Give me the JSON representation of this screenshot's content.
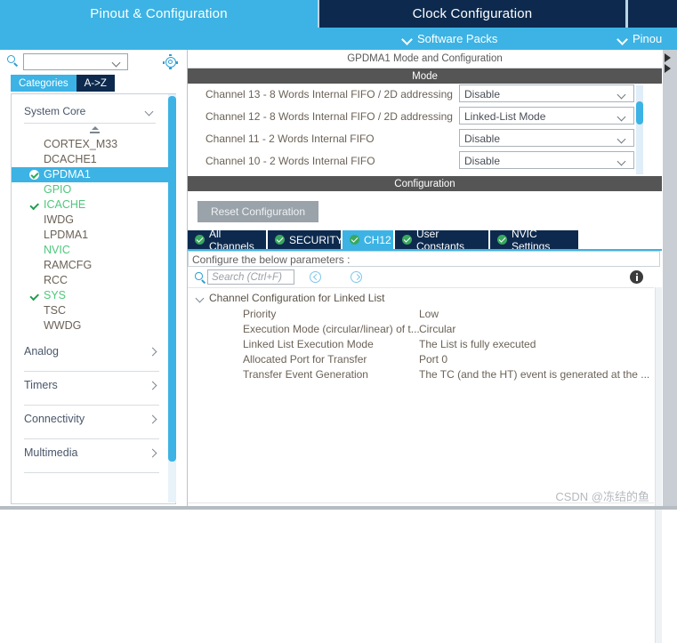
{
  "tabs": {
    "pinout_configuration": "Pinout & Configuration",
    "clock_configuration": "Clock Configuration",
    "right_stub": ""
  },
  "subbar": {
    "software_packs": "Software Packs",
    "pinout": "Pinou"
  },
  "sidebar": {
    "search_value": "",
    "search_placeholder": "",
    "pill_categories": "Categories",
    "pill_az": "A->Z",
    "group_header": "System Core",
    "peripherals": [
      {
        "label": "CORTEX_M33",
        "state": "none"
      },
      {
        "label": "DCACHE1",
        "state": "none"
      },
      {
        "label": "GPDMA1",
        "state": "selected"
      },
      {
        "label": "GPIO",
        "state": "configured"
      },
      {
        "label": "ICACHE",
        "state": "checked"
      },
      {
        "label": "IWDG",
        "state": "none"
      },
      {
        "label": "LPDMA1",
        "state": "none"
      },
      {
        "label": "NVIC",
        "state": "configured"
      },
      {
        "label": "RAMCFG",
        "state": "none"
      },
      {
        "label": "RCC",
        "state": "none"
      },
      {
        "label": "SYS",
        "state": "checked"
      },
      {
        "label": "TSC",
        "state": "none"
      },
      {
        "label": "WWDG",
        "state": "none"
      }
    ],
    "categories": [
      {
        "label": "Analog"
      },
      {
        "label": "Timers"
      },
      {
        "label": "Connectivity"
      },
      {
        "label": "Multimedia"
      }
    ]
  },
  "main": {
    "title": "GPDMA1 Mode and Configuration",
    "mode_header": "Mode",
    "mode_rows": [
      {
        "label": "Channel 13 - 8 Words Internal FIFO / 2D addressing",
        "value": "Disable"
      },
      {
        "label": "Channel 12 - 8 Words Internal FIFO / 2D addressing",
        "value": "Linked-List Mode"
      },
      {
        "label": "Channel 11  - 2 Words Internal FIFO",
        "value": "Disable"
      },
      {
        "label": "Channel 10  - 2 Words Internal FIFO",
        "value": "Disable"
      }
    ],
    "configuration_header": "Configuration",
    "reset_button": "Reset Configuration",
    "config_tabs": [
      {
        "label": "All Channels",
        "active": false
      },
      {
        "label": "SECURITY",
        "active": false
      },
      {
        "label": "CH12",
        "active": true
      },
      {
        "label": "User Constants",
        "active": false
      },
      {
        "label": "NVIC Settings",
        "active": false
      }
    ],
    "configure_hint": "Configure the below parameters :",
    "search_placeholder": "Search (Ctrl+F)",
    "search_value": "",
    "tree_group": "Channel Configuration for Linked List",
    "parameters": [
      {
        "name": "Priority",
        "value": "Low"
      },
      {
        "name": "Execution Mode (circular/linear) of t...",
        "value": "Circular"
      },
      {
        "name": "Linked List Execution Mode",
        "value": "The List is fully executed"
      },
      {
        "name": "Allocated Port for Transfer",
        "value": "Port 0"
      },
      {
        "name": "Transfer Event Generation",
        "value": "The TC (and the HT) event is generated at the ..."
      }
    ]
  },
  "watermark": "CSDN @冻结的鱼",
  "colors": {
    "accent_blue": "#3cb3e4",
    "dark_navy": "#0d2a4e",
    "header_gray": "#555555",
    "green_check": "#2bae5e"
  }
}
